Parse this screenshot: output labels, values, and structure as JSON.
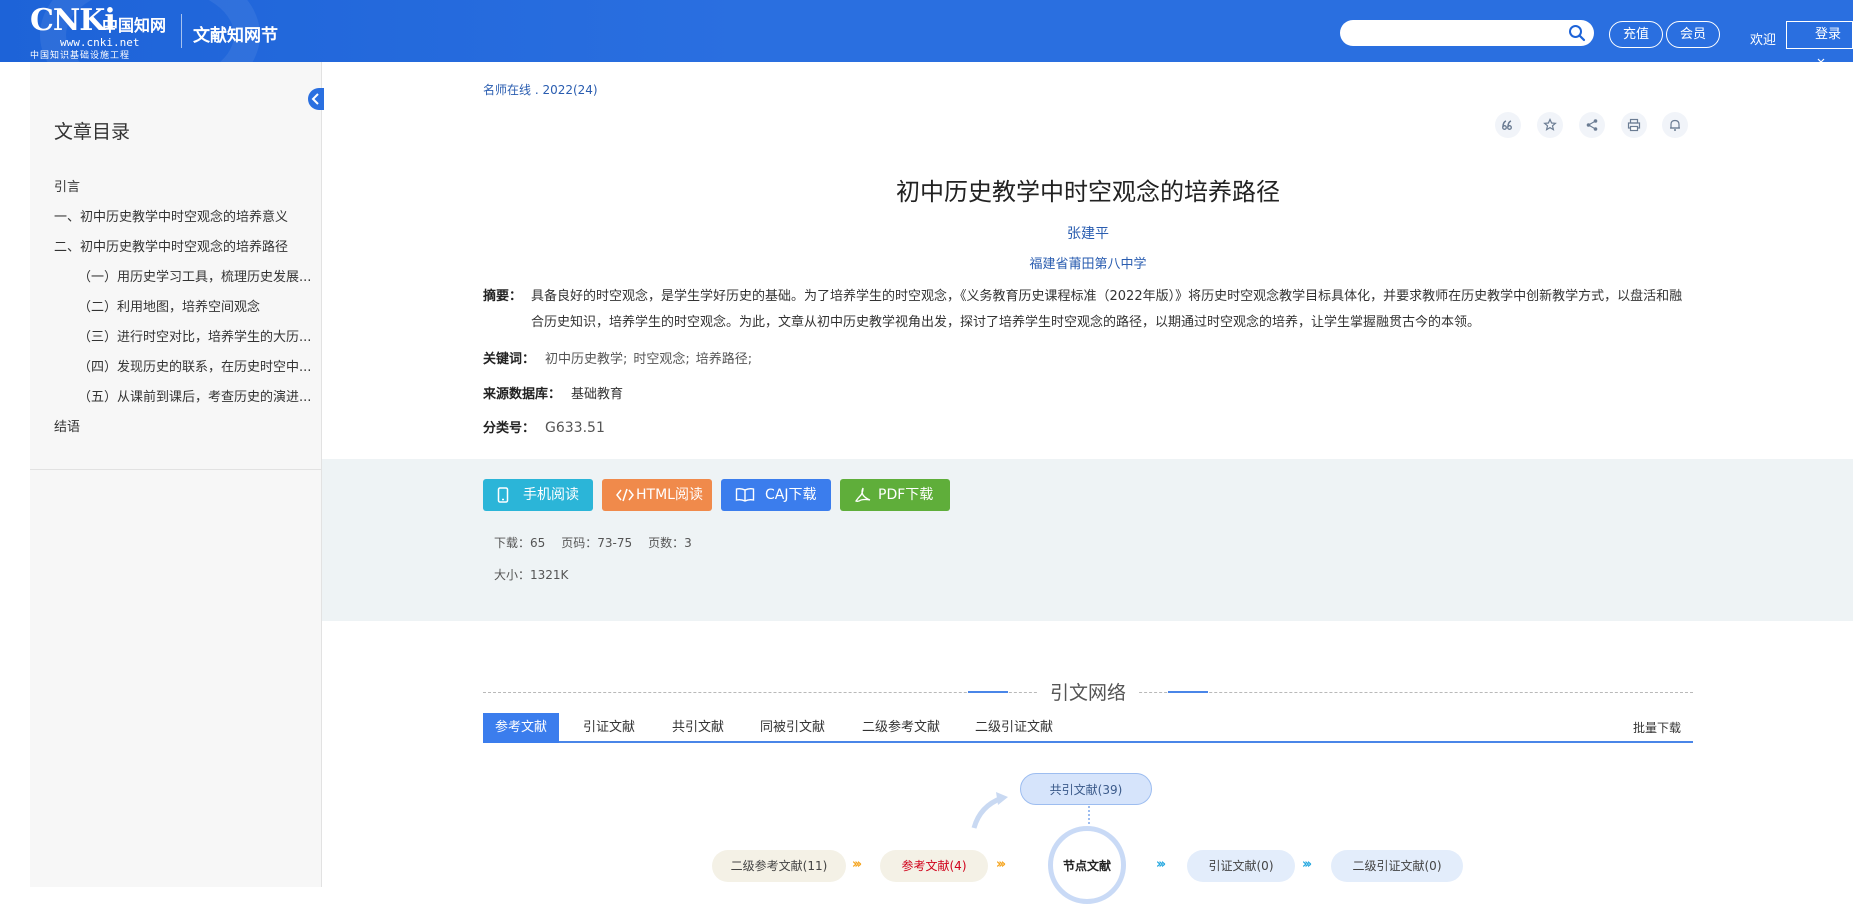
{
  "header": {
    "logo_mark": "CNKi",
    "logo_cn": "中国知网",
    "logo_url": "www.cnki.net",
    "logo_sub": "中国知识基础设施工程",
    "site_name": "文献知网节",
    "search_placeholder": "",
    "recharge_label": "充值",
    "member_label": "会员",
    "welcome_label": "欢迎",
    "login_label": "登录"
  },
  "sidebar": {
    "title": "文章目录",
    "items": [
      {
        "label": "引言",
        "level": 1
      },
      {
        "label": "一、初中历史教学中时空观念的培养意义",
        "level": 1
      },
      {
        "label": "二、初中历史教学中时空观念的培养路径",
        "level": 1
      },
      {
        "label": "（一）用历史学习工具，梳理历史发展...",
        "level": 2
      },
      {
        "label": "（二）利用地图，培养空间观念",
        "level": 2
      },
      {
        "label": "（三）进行时空对比，培养学生的大历...",
        "level": 2
      },
      {
        "label": "（四）发现历史的联系，在历史时空中...",
        "level": 2
      },
      {
        "label": "（五）从课前到课后，考查历史的演进...",
        "level": 2
      },
      {
        "label": "结语",
        "level": 1
      }
    ]
  },
  "article": {
    "source": "名师在线 . 2022(24)",
    "title": "初中历史教学中时空观念的培养路径",
    "author": "张建平",
    "org": "福建省莆田第八中学",
    "abstract_label": "摘要：",
    "abstract": "具备良好的时空观念，是学生学好历史的基础。为了培养学生的时空观念，《义务教育历史课程标准（2022年版）》将历史时空观念教学目标具体化，并要求教师在历史教学中创新教学方式，以盘活和融合历史知识，培养学生的时空观念。为此，文章从初中历史教学视角出发，探讨了培养学生时空观念的路径，以期通过时空观念的培养，让学生掌握融贯古今的本领。",
    "keywords_label": "关键词：",
    "keywords": [
      "初中历史教学;",
      "时空观念;",
      "培养路径;"
    ],
    "database_label": "来源数据库：",
    "database": "基础教育",
    "class_label": "分类号：",
    "class_no": "G633.51"
  },
  "actions": {
    "mobile": "手机阅读",
    "html": "HTML阅读",
    "caj": "CAJ下载",
    "pdf": "PDF下载",
    "downloads": "下载：65",
    "pages_range": "页码：73-75",
    "page_count": "页数：3",
    "size": "大小：1321K"
  },
  "network": {
    "title": "引文网络",
    "tabs": [
      "参考文献",
      "引证文献",
      "共引文献",
      "同被引文献",
      "二级参考文献",
      "二级引证文献"
    ],
    "batch_download": "批量下载",
    "nodes": {
      "co_cite": "共引文献(39)",
      "sec_ref": "二级参考文献(11)",
      "ref": "参考文献(4)",
      "center": "节点文献",
      "cited": "引证文献(0)",
      "sec_cited": "二级引证文献(0)"
    }
  },
  "colors": {
    "header_blue": "#2a6fe0",
    "link_blue": "#2a5db0",
    "mobile_btn": "#2bb5d8",
    "html_btn": "#f08a4b",
    "caj_btn": "#3b7ded",
    "pdf_btn": "#5fae3a"
  }
}
